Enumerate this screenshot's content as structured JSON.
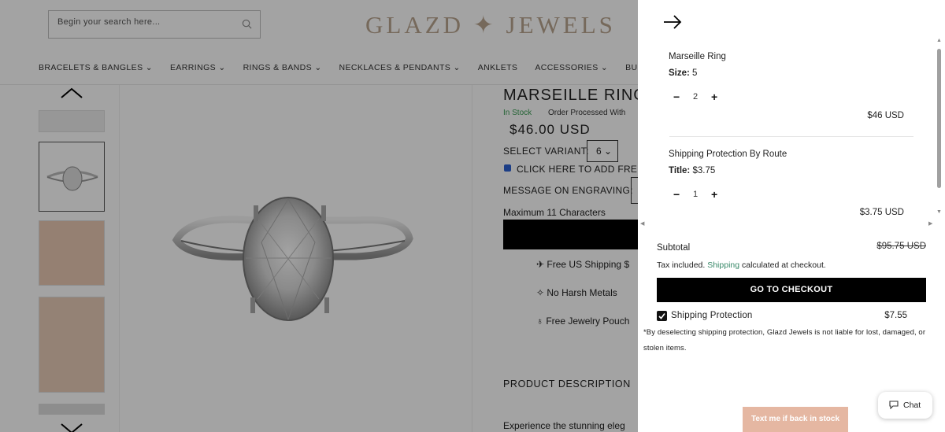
{
  "header": {
    "search_placeholder": "Begin your search here...",
    "logo": "GLAZD ✦ JEWELS",
    "nav": [
      "BRACELETS & BANGLES ⌄",
      "EARRINGS ⌄",
      "RINGS & BANDS ⌄",
      "NECKLACES & PENDANTS ⌄",
      "ANKLETS",
      "ACCESSORIES ⌄",
      "BUNDLES & SE"
    ]
  },
  "product": {
    "title": "MARSEILLE RING",
    "stock": "In Stock",
    "processed": "Order Processed With",
    "price": "$46.00 USD",
    "variant_label": "SELECT VARIANT:",
    "variant_value": "6 ⌄",
    "engraving_checkbox": "CLICK HERE TO ADD FREE",
    "message_label": "MESSAGE ON ENGRAVING:",
    "max_chars": "Maximum 11 Characters",
    "features": [
      "Free US Shipping $",
      "No Harsh Metals",
      "Free Jewelry Pouch"
    ],
    "description_heading": "PRODUCT DESCRIPTION",
    "description_start": "Experience the stunning eleg"
  },
  "cart": {
    "items": [
      {
        "name": "Marseille Ring",
        "option_label": "Size:",
        "option_value": "5",
        "qty": "2",
        "price": "$46 USD"
      },
      {
        "name": "Shipping Protection By Route",
        "option_label": "Title:",
        "option_value": "$3.75",
        "qty": "1",
        "price": "$3.75 USD"
      }
    ],
    "subtotal_label": "Subtotal",
    "subtotal_value": "$95.75 USD",
    "tax_prefix": "Tax included. ",
    "tax_link": "Shipping",
    "tax_suffix": " calculated at checkout.",
    "checkout_label": "GO TO CHECKOUT",
    "protection_label": "Shipping Protection",
    "protection_value": "$7.55",
    "protection_note": "*By deselecting shipping protection, Glazd Jewels is not liable for lost, damaged, or stolen items."
  },
  "widgets": {
    "text_me": "Text me if back in stock",
    "chat": "Chat"
  },
  "colors": {
    "accent_green": "#3a9d54",
    "checkout_bg": "#000000",
    "text_me_bg": "#e5b7a2",
    "logo": "#b9a48f"
  }
}
